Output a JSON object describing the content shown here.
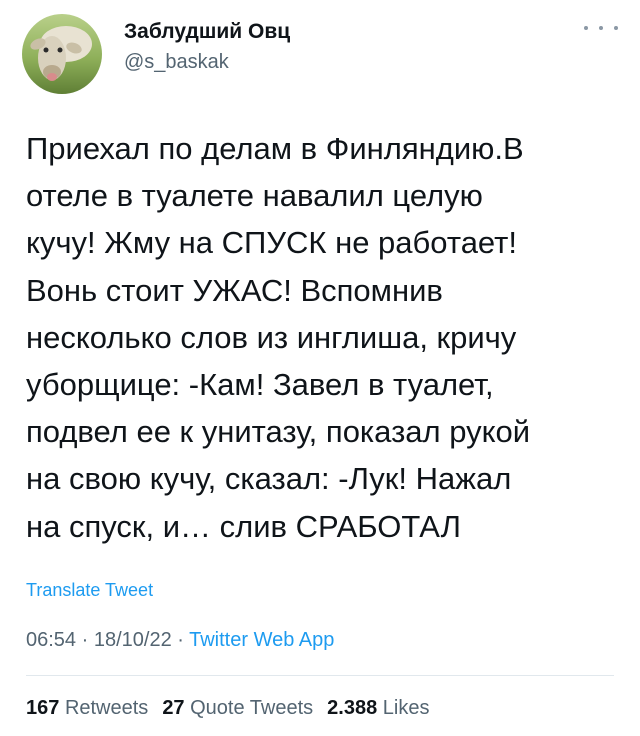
{
  "author": {
    "display_name": "Заблудший Овц",
    "handle": "@s_baskak",
    "avatar_icon": "sheep-avatar"
  },
  "more_icon": "ellipsis-icon",
  "tweet": {
    "lines": [
      "Приехал по делам в Финляндию.В",
      "отеле в туалете навалил целую",
      "кучу! Жму на СПУСК не работает!",
      "Вонь стоит УЖАС! Вспомнив",
      "несколько слов из инглиша, кричу",
      "уборщице: -Кам! Завел в туалет,",
      "подвел ее к унитазу, показал рукой",
      "на свою кучу, сказал: -Лук! Нажал",
      "на спуск, и… слив СРАБОТАЛ"
    ],
    "translate_label": "Translate Tweet",
    "time": "06:54",
    "separator": " · ",
    "date": "18/10/22",
    "source": "Twitter Web App"
  },
  "stats": {
    "retweets_count": "167",
    "retweets_label": "Retweets",
    "quotes_count": "27",
    "quotes_label": "Quote Tweets",
    "likes_count": "2.388",
    "likes_label": "Likes"
  },
  "colors": {
    "link": "#1d9bf0",
    "secondary": "#536471",
    "text": "#0f1419"
  }
}
